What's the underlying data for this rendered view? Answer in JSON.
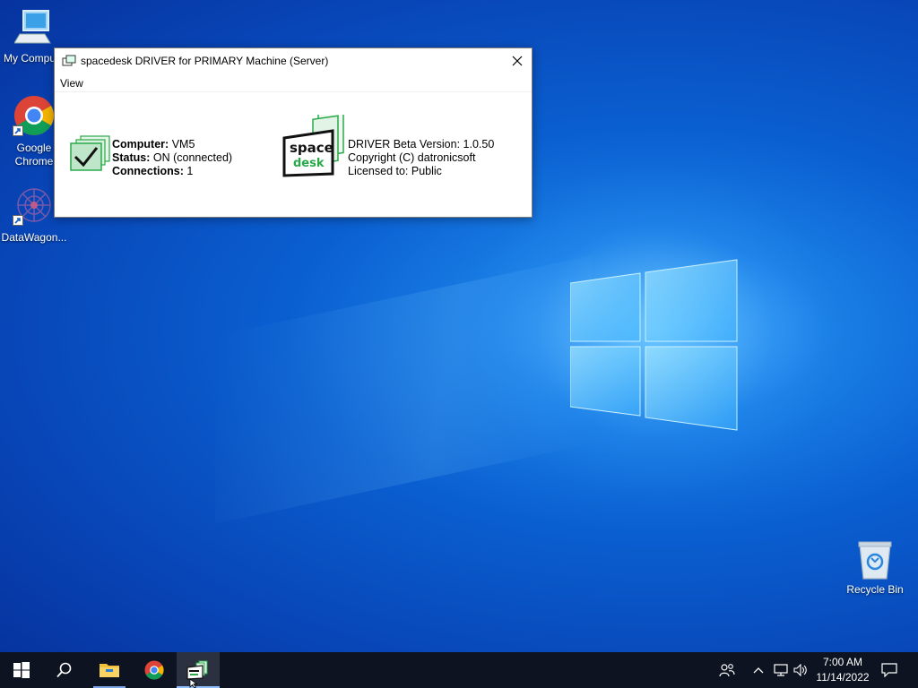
{
  "desktop": {
    "icons": [
      {
        "label": "My Compu..."
      },
      {
        "label": "Google Chrome"
      },
      {
        "label": "DataWagon..."
      }
    ],
    "recycle_bin": {
      "label": "Recycle Bin"
    }
  },
  "dialog": {
    "title": "spacedesk DRIVER for PRIMARY Machine (Server)",
    "menu": {
      "view": "View"
    },
    "status": {
      "computer_label": "Computer:",
      "computer_value": "VM5",
      "status_label": "Status:",
      "status_value": "ON (connected)",
      "connections_label": "Connections:",
      "connections_value": "1"
    },
    "about": {
      "version": "DRIVER Beta Version: 1.0.50",
      "copyright": "Copyright (C) datronicsoft",
      "license": "Licensed to:  Public"
    },
    "logo_text": {
      "line1": "space",
      "line2": "desk"
    }
  },
  "taskbar": {
    "clock": {
      "time": "7:00 AM",
      "date": "11/14/2022"
    },
    "colors": {
      "bg": "#0d1320",
      "active": "#2b3140",
      "accent": "#8fbfff"
    }
  },
  "colors": {
    "desktop_blue": "#0a5fd0",
    "check_green": "#2aa84a"
  }
}
